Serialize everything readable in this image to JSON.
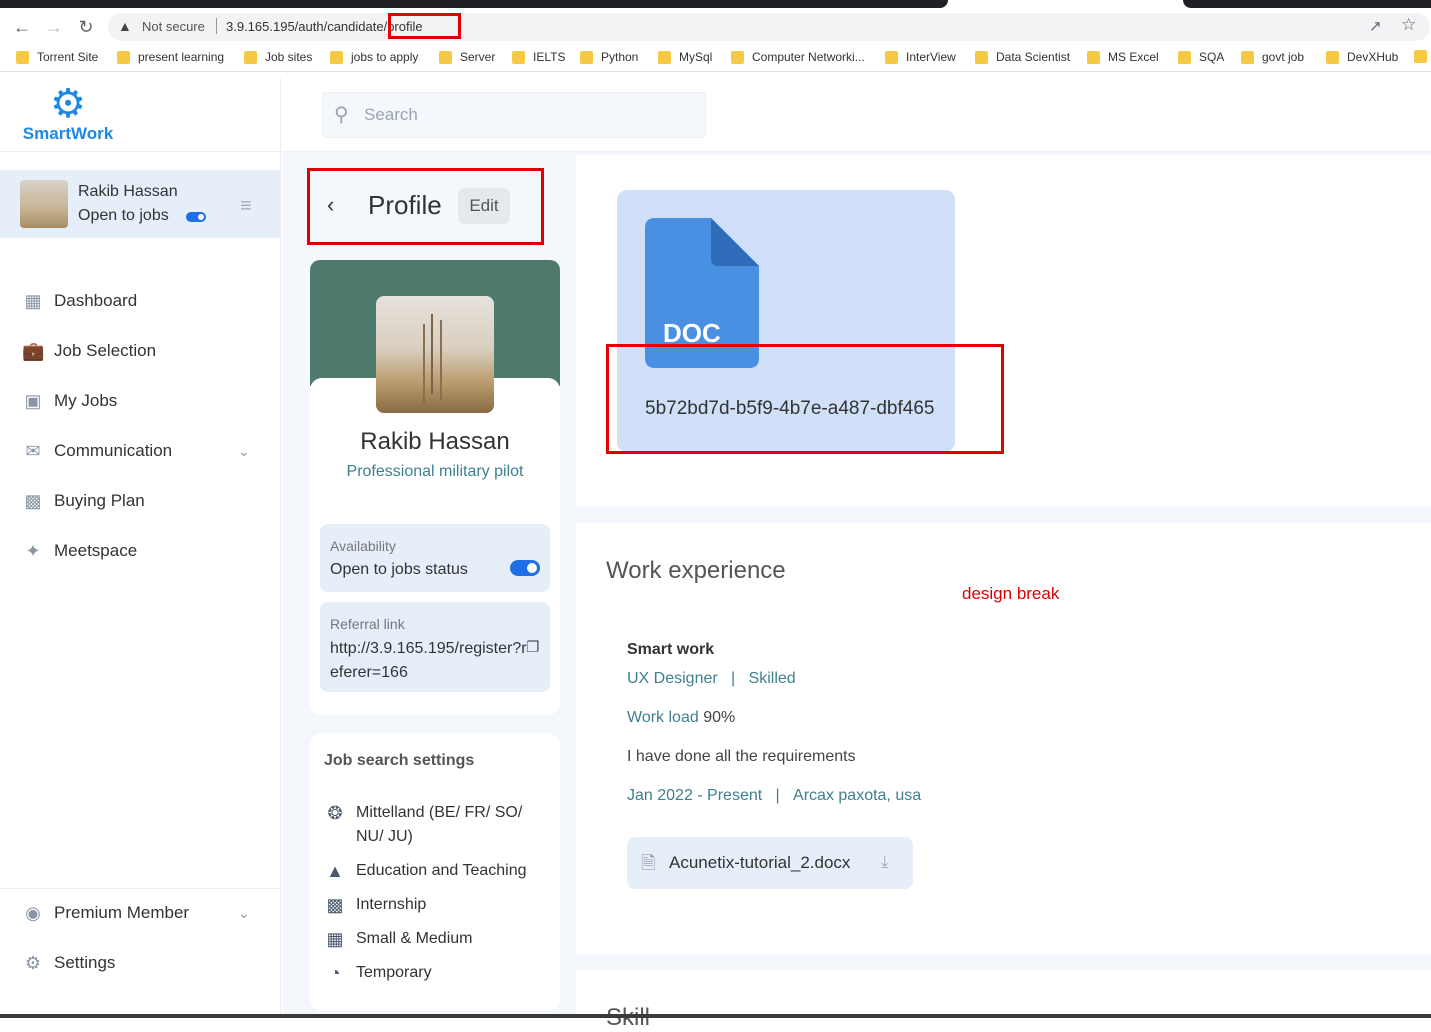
{
  "browser": {
    "not_secure": "Not secure",
    "url": "3.9.165.195/auth/candidate/profile",
    "bookmarks": [
      "Torrent Site",
      "present learning",
      "Job sites",
      "jobs to apply",
      "Server",
      "IELTS",
      "Python",
      "MySql",
      "Computer Networki...",
      "InterView",
      "Data Scientist",
      "MS Excel",
      "SQA",
      "govt job",
      "DevXHub"
    ]
  },
  "sidebar": {
    "logo": "SmartWork",
    "user": {
      "name": "Rakib Hassan",
      "status": "Open to jobs"
    },
    "nav": [
      {
        "label": "Dashboard",
        "icon": "dashboard-icon"
      },
      {
        "label": "Job Selection",
        "icon": "briefcase-icon"
      },
      {
        "label": "My Jobs",
        "icon": "my-jobs-icon"
      },
      {
        "label": "Communication",
        "icon": "chat-icon"
      },
      {
        "label": "Buying Plan",
        "icon": "plan-icon"
      },
      {
        "label": "Meetspace",
        "icon": "meetspace-icon"
      }
    ],
    "bottom": [
      {
        "label": "Premium Member",
        "icon": "premium-icon"
      },
      {
        "label": "Settings",
        "icon": "settings-icon"
      }
    ]
  },
  "search": {
    "placeholder": "Search"
  },
  "profile": {
    "title": "Profile",
    "edit": "Edit",
    "name": "Rakib Hassan",
    "role": "Professional military pilot",
    "availability_label": "Availability",
    "availability_value": "Open to jobs status",
    "referral_label": "Referral link",
    "referral_value": "http://3.9.165.195/register?referer=166"
  },
  "job_search": {
    "title": "Job search settings",
    "items": [
      {
        "label": "Mittelland (BE/ FR/ SO/ NU/ JU)",
        "icon": "compass-icon"
      },
      {
        "label": "Education and Teaching",
        "icon": "shapes-icon"
      },
      {
        "label": "Internship",
        "icon": "briefcase-icon"
      },
      {
        "label": "Small & Medium",
        "icon": "building-icon"
      },
      {
        "label": "Temporary",
        "icon": "clock-icon"
      }
    ]
  },
  "document": {
    "type": "DOC",
    "filename": "5b72bd7d-b5f9-4b7e-a487-dbf465"
  },
  "work": {
    "title": "Work experience",
    "annotation": "design break",
    "company": "Smart work",
    "position": "UX Designer",
    "level": "Skilled",
    "meta_sep": "|",
    "load_label": "Work load",
    "load_value": "90%",
    "description": "I have done all the requirements",
    "dates": "Jan 2022 - Present",
    "location": "Arcax paxota, usa",
    "attachment": "Acunetix-tutorial_2.docx"
  },
  "skills": {
    "title": "Skill"
  },
  "colors": {
    "accent": "#1e6fe8",
    "banner": "#4e7a6e",
    "highlight": "#e00000",
    "teal_text": "#3e7f90"
  }
}
